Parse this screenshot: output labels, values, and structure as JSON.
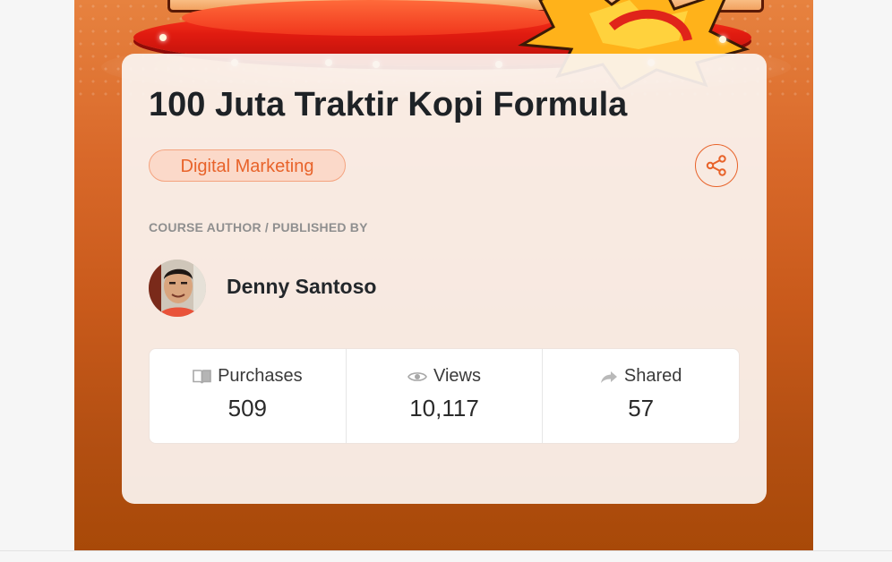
{
  "course": {
    "title": "100 Juta Traktir Kopi Formula",
    "category": "Digital Marketing"
  },
  "author": {
    "label": "COURSE AUTHOR / PUBLISHED BY",
    "name": "Denny Santoso"
  },
  "stats": [
    {
      "label": "Purchases",
      "value": "509",
      "icon": "book-icon"
    },
    {
      "label": "Views",
      "value": "10,117",
      "icon": "eye-icon"
    },
    {
      "label": "Shared",
      "value": "57",
      "icon": "share-arrow-icon"
    }
  ],
  "colors": {
    "accent": "#e8632a",
    "badge_bg": "#fbd9c9",
    "hero_top": "#e7823f",
    "hero_bottom": "#a84908",
    "card_bg": "#fbf4f0"
  }
}
